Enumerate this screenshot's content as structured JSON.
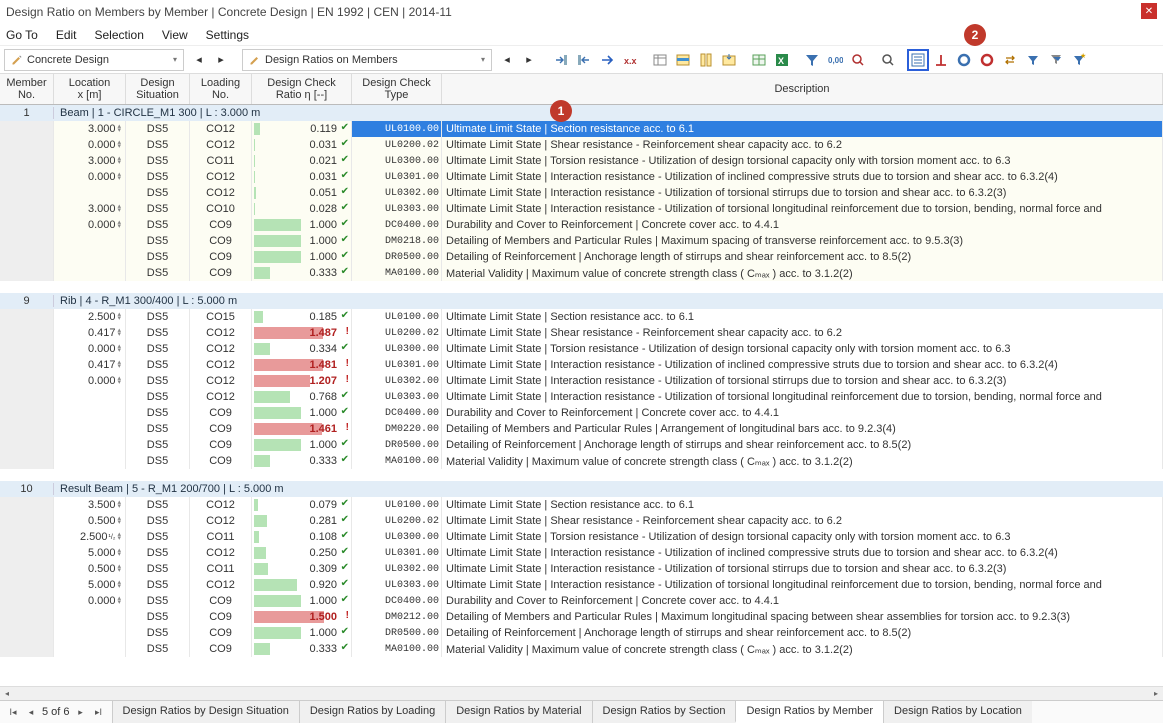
{
  "window": {
    "title": "Design Ratio on Members by Member | Concrete Design | EN 1992 | CEN | 2014-11"
  },
  "menu": [
    "Go To",
    "Edit",
    "Selection",
    "View",
    "Settings"
  ],
  "selectors": {
    "left": "Concrete Design",
    "right": "Design Ratios on Members"
  },
  "toolbar_icons": [
    "arrow-in",
    "arrow-out",
    "arrow-right-blue",
    "xx-icon",
    "filter-table",
    "row-select",
    "column-fit",
    "export",
    "table-view",
    "excel",
    "filter-funnel",
    "digits-000",
    "find",
    "zoom",
    "details-view",
    "perp-icon",
    "ring-blue",
    "ring-red",
    "swap",
    "funnel-small",
    "funnel-stack",
    "funnel-star"
  ],
  "headers": {
    "member": [
      "Member",
      "No."
    ],
    "loc": [
      "Location",
      "x [m]"
    ],
    "ds": [
      "Design",
      "Situation"
    ],
    "ln": [
      "Loading",
      "No."
    ],
    "ratio": [
      "Design Check",
      "Ratio η [--]"
    ],
    "type": [
      "Design Check",
      "Type"
    ],
    "desc": "Description"
  },
  "annotations": {
    "one": "1",
    "two": "2"
  },
  "groups": [
    {
      "no": "1",
      "label": "Beam | 1 - CIRCLE_M1 300 | L : 3.000 m",
      "alt": true,
      "rows": [
        {
          "sel": true,
          "loc": "3.000",
          "ds": "DS5",
          "ln": "CO12",
          "ratio": 0.119,
          "type": "UL0100.00",
          "desc": "Ultimate Limit State | Section resistance acc. to 6.1"
        },
        {
          "loc": "0.000",
          "ds": "DS5",
          "ln": "CO12",
          "ratio": 0.031,
          "type": "UL0200.02",
          "desc": "Ultimate Limit State | Shear resistance - Reinforcement shear capacity acc. to 6.2"
        },
        {
          "loc": "3.000",
          "ds": "DS5",
          "ln": "CO11",
          "ratio": 0.021,
          "type": "UL0300.00",
          "desc": "Ultimate Limit State | Torsion resistance - Utilization of design torsional capacity only with torsion moment acc. to 6.3"
        },
        {
          "loc": "0.000",
          "ds": "DS5",
          "ln": "CO12",
          "ratio": 0.031,
          "type": "UL0301.00",
          "desc": "Ultimate Limit State | Interaction resistance - Utilization of inclined compressive struts due to torsion and shear acc. to 6.3.2(4)"
        },
        {
          "loc": "",
          "ds": "DS5",
          "ln": "CO12",
          "ratio": 0.051,
          "type": "UL0302.00",
          "desc": "Ultimate Limit State | Interaction resistance - Utilization of torsional stirrups due to torsion and shear acc. to 6.3.2(3)"
        },
        {
          "loc": "3.000",
          "ds": "DS5",
          "ln": "CO10",
          "ratio": 0.028,
          "type": "UL0303.00",
          "desc": "Ultimate Limit State | Interaction resistance - Utilization of torsional longitudinal reinforcement due to torsion, bending, normal force and"
        },
        {
          "loc": "0.000",
          "ds": "DS5",
          "ln": "CO9",
          "ratio": 1.0,
          "type": "DC0400.00",
          "desc": "Durability and Cover to Reinforcement | Concrete cover acc. to 4.4.1"
        },
        {
          "loc": "",
          "ds": "DS5",
          "ln": "CO9",
          "ratio": 1.0,
          "type": "DM0218.00",
          "desc": "Detailing of Members and Particular Rules | Maximum spacing of transverse reinforcement acc. to 9.5.3(3)"
        },
        {
          "loc": "",
          "ds": "DS5",
          "ln": "CO9",
          "ratio": 1.0,
          "type": "DR0500.00",
          "desc": "Detailing of Reinforcement | Anchorage length of stirrups and shear reinforcement acc. to 8.5(2)"
        },
        {
          "loc": "",
          "ds": "DS5",
          "ln": "CO9",
          "ratio": 0.333,
          "type": "MA0100.00",
          "desc": "Material Validity | Maximum value of concrete strength class ( Cₘₐₓ ) acc. to 3.1.2(2)"
        }
      ]
    },
    {
      "no": "9",
      "label": "Rib | 4 - R_M1 300/400 | L : 5.000 m",
      "alt": false,
      "rows": [
        {
          "loc": "2.500",
          "ds": "DS5",
          "ln": "CO15",
          "ratio": 0.185,
          "type": "UL0100.00",
          "desc": "Ultimate Limit State | Section resistance acc. to 6.1"
        },
        {
          "loc": "0.417",
          "ds": "DS5",
          "ln": "CO12",
          "ratio": 1.487,
          "type": "UL0200.02",
          "desc": "Ultimate Limit State | Shear resistance - Reinforcement shear capacity acc. to 6.2"
        },
        {
          "loc": "0.000",
          "ds": "DS5",
          "ln": "CO12",
          "ratio": 0.334,
          "type": "UL0300.00",
          "desc": "Ultimate Limit State | Torsion resistance - Utilization of design torsional capacity only with torsion moment acc. to 6.3"
        },
        {
          "loc": "0.417",
          "ds": "DS5",
          "ln": "CO12",
          "ratio": 1.481,
          "type": "UL0301.00",
          "desc": "Ultimate Limit State | Interaction resistance - Utilization of inclined compressive struts due to torsion and shear acc. to 6.3.2(4)"
        },
        {
          "loc": "0.000",
          "ds": "DS5",
          "ln": "CO12",
          "ratio": 1.207,
          "type": "UL0302.00",
          "desc": "Ultimate Limit State | Interaction resistance - Utilization of torsional stirrups due to torsion and shear acc. to 6.3.2(3)"
        },
        {
          "loc": "",
          "ds": "DS5",
          "ln": "CO12",
          "ratio": 0.768,
          "type": "UL0303.00",
          "desc": "Ultimate Limit State | Interaction resistance - Utilization of torsional longitudinal reinforcement due to torsion, bending, normal force and"
        },
        {
          "loc": "",
          "ds": "DS5",
          "ln": "CO9",
          "ratio": 1.0,
          "type": "DC0400.00",
          "desc": "Durability and Cover to Reinforcement | Concrete cover acc. to 4.4.1"
        },
        {
          "loc": "",
          "ds": "DS5",
          "ln": "CO9",
          "ratio": 1.461,
          "type": "DM0220.00",
          "desc": "Detailing of Members and Particular Rules | Arrangement of longitudinal bars acc. to 9.2.3(4)"
        },
        {
          "loc": "",
          "ds": "DS5",
          "ln": "CO9",
          "ratio": 1.0,
          "type": "DR0500.00",
          "desc": "Detailing of Reinforcement | Anchorage length of stirrups and shear reinforcement acc. to 8.5(2)"
        },
        {
          "loc": "",
          "ds": "DS5",
          "ln": "CO9",
          "ratio": 0.333,
          "type": "MA0100.00",
          "desc": "Material Validity | Maximum value of concrete strength class ( Cₘₐₓ ) acc. to 3.1.2(2)"
        }
      ]
    },
    {
      "no": "10",
      "label": "Result Beam | 5 - R_M1 200/700 | L : 5.000 m",
      "alt": false,
      "rows": [
        {
          "loc": "3.500",
          "ds": "DS5",
          "ln": "CO12",
          "ratio": 0.079,
          "type": "UL0100.00",
          "desc": "Ultimate Limit State | Section resistance acc. to 6.1"
        },
        {
          "loc": "0.500",
          "ds": "DS5",
          "ln": "CO12",
          "ratio": 0.281,
          "type": "UL0200.02",
          "desc": "Ultimate Limit State | Shear resistance - Reinforcement shear capacity acc. to 6.2"
        },
        {
          "loc": "2.500",
          "loc_sub": "¹/₂",
          "ds": "DS5",
          "ln": "CO11",
          "ratio": 0.108,
          "type": "UL0300.00",
          "desc": "Ultimate Limit State | Torsion resistance - Utilization of design torsional capacity only with torsion moment acc. to 6.3"
        },
        {
          "loc": "5.000",
          "ds": "DS5",
          "ln": "CO12",
          "ratio": 0.25,
          "type": "UL0301.00",
          "desc": "Ultimate Limit State | Interaction resistance - Utilization of inclined compressive struts due to torsion and shear acc. to 6.3.2(4)"
        },
        {
          "loc": "0.500",
          "ds": "DS5",
          "ln": "CO11",
          "ratio": 0.309,
          "type": "UL0302.00",
          "desc": "Ultimate Limit State | Interaction resistance - Utilization of torsional stirrups due to torsion and shear acc. to 6.3.2(3)"
        },
        {
          "loc": "5.000",
          "ds": "DS5",
          "ln": "CO12",
          "ratio": 0.92,
          "type": "UL0303.00",
          "desc": "Ultimate Limit State | Interaction resistance - Utilization of torsional longitudinal reinforcement due to torsion, bending, normal force and"
        },
        {
          "loc": "0.000",
          "ds": "DS5",
          "ln": "CO9",
          "ratio": 1.0,
          "type": "DC0400.00",
          "desc": "Durability and Cover to Reinforcement | Concrete cover acc. to 4.4.1"
        },
        {
          "loc": "",
          "ds": "DS5",
          "ln": "CO9",
          "ratio": 1.5,
          "type": "DM0212.00",
          "desc": "Detailing of Members and Particular Rules | Maximum longitudinal spacing between shear assemblies for torsion acc. to 9.2.3(3)"
        },
        {
          "loc": "",
          "ds": "DS5",
          "ln": "CO9",
          "ratio": 1.0,
          "type": "DR0500.00",
          "desc": "Detailing of Reinforcement | Anchorage length of stirrups and shear reinforcement acc. to 8.5(2)"
        },
        {
          "loc": "",
          "ds": "DS5",
          "ln": "CO9",
          "ratio": 0.333,
          "type": "MA0100.00",
          "desc": "Material Validity | Maximum value of concrete strength class ( Cₘₐₓ ) acc. to 3.1.2(2)"
        }
      ]
    }
  ],
  "pager": {
    "pos": "5 of 6"
  },
  "tabs": [
    {
      "label": "Design Ratios by Design Situation",
      "active": false
    },
    {
      "label": "Design Ratios by Loading",
      "active": false
    },
    {
      "label": "Design Ratios by Material",
      "active": false
    },
    {
      "label": "Design Ratios by Section",
      "active": false
    },
    {
      "label": "Design Ratios by Member",
      "active": true
    },
    {
      "label": "Design Ratios by Location",
      "active": false
    }
  ]
}
